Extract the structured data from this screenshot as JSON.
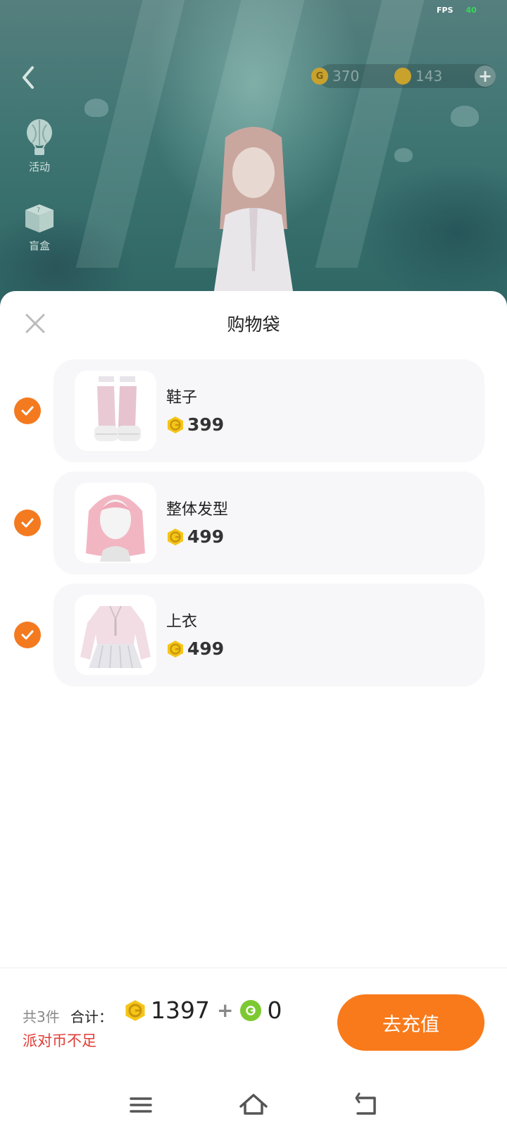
{
  "status": {
    "fps_label": "FPS",
    "fps_value": "40"
  },
  "game": {
    "currency": [
      {
        "icon": "gold-coin-icon",
        "value": "370"
      },
      {
        "icon": "gold-coin-icon",
        "value": "143"
      }
    ],
    "side_menu": [
      {
        "icon": "hot-air-balloon-icon",
        "label": "活动"
      },
      {
        "icon": "gift-box-icon",
        "label": "盲盒"
      }
    ]
  },
  "cart": {
    "title": "购物袋",
    "items": [
      {
        "name": "鞋子",
        "price": "399",
        "checked": true,
        "thumb": "shoes-thumbnail"
      },
      {
        "name": "整体发型",
        "price": "499",
        "checked": true,
        "thumb": "hairstyle-thumbnail"
      },
      {
        "name": "上衣",
        "price": "499",
        "checked": true,
        "thumb": "top-thumbnail"
      }
    ]
  },
  "footer": {
    "count_label": "共3件",
    "total_label": "合计：",
    "total_coins": "1397",
    "plus": "+",
    "total_party": "0",
    "warning": "派对币不足",
    "recharge_button": "去充值"
  },
  "colors": {
    "accent": "#f97a1a",
    "warning": "#e03b34",
    "coin": "#f5c518",
    "party_coin": "#7cc932"
  }
}
